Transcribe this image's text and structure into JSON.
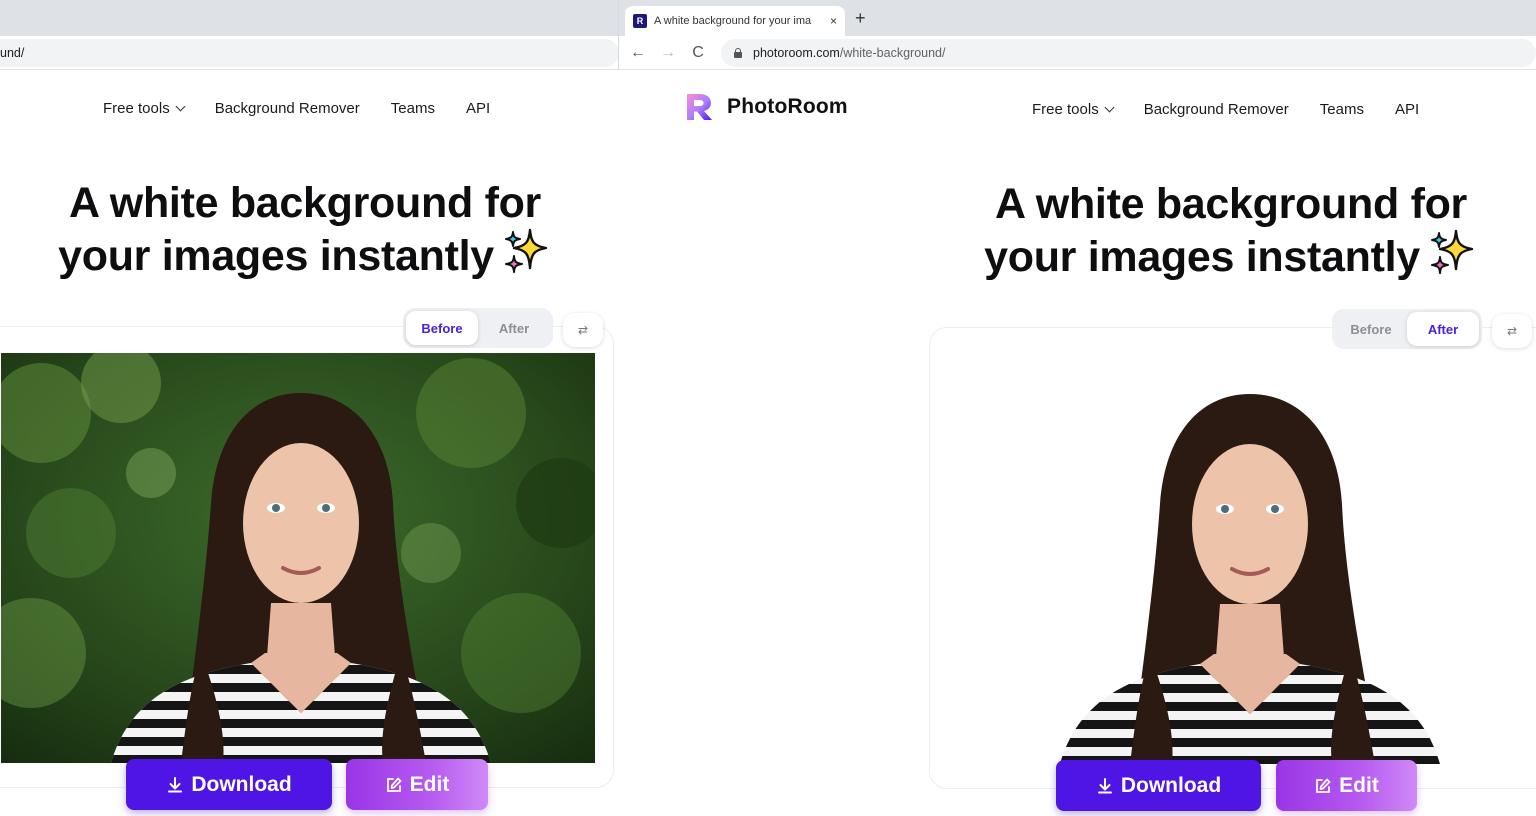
{
  "browser": {
    "tab_title": "A white background for your ima",
    "tab_close": "×",
    "new_tab": "+",
    "back": "←",
    "forward": "→",
    "reload": "C",
    "url_host": "photoroom.com",
    "url_path": "/white-background/",
    "left_url_fragment": "und/"
  },
  "site": {
    "logo_text": "PhotoRoom",
    "nav": {
      "free_tools": "Free tools",
      "background_remover": "Background Remover",
      "teams": "Teams",
      "api": "API"
    },
    "hero_line1": "A white background for",
    "hero_line2": "your images instantly"
  },
  "left_view": {
    "toggle_before": "Before",
    "toggle_after": "After",
    "active": "Before",
    "download_label": "Download",
    "edit_label": "Edit"
  },
  "right_view": {
    "toggle_before": "Before",
    "toggle_after": "After",
    "active": "After",
    "download_label": "Download",
    "edit_label": "Edit"
  },
  "swap_glyph": "⇄",
  "colors": {
    "primary": "#4f15e4",
    "edit_gradient_start": "#9a35e6",
    "edit_gradient_end": "#cf8af7",
    "toggle_active_text": "#4b21d6"
  },
  "icons": [
    "download-icon",
    "edit-icon",
    "sparkle-icon",
    "swap-icon",
    "lock-icon",
    "photoroom-logo-icon",
    "chevron-down-icon"
  ]
}
